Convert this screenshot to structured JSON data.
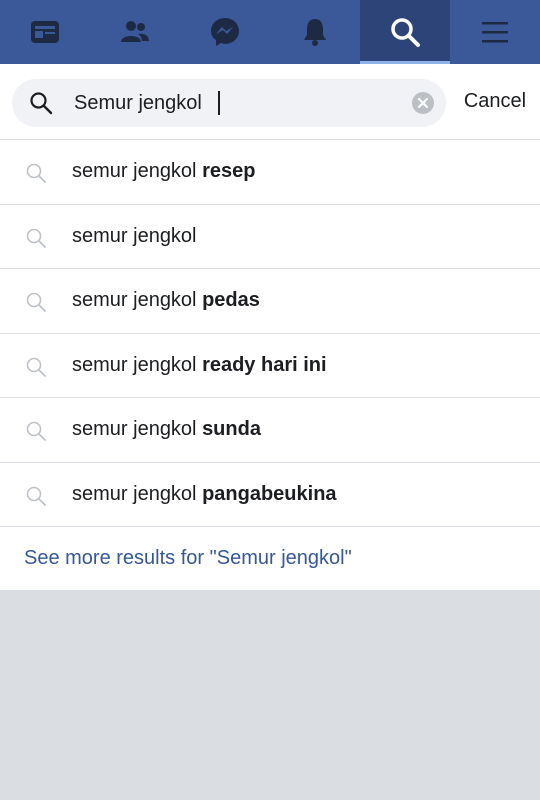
{
  "nav": {
    "items": [
      {
        "icon": "news-feed-icon"
      },
      {
        "icon": "friends-icon"
      },
      {
        "icon": "messenger-icon"
      },
      {
        "icon": "notifications-bell-icon"
      },
      {
        "icon": "search-icon",
        "active": true
      },
      {
        "icon": "menu-icon"
      }
    ],
    "colors": {
      "bar": "#3b5998",
      "active": "#2d4479",
      "indicator": "#8eb3e8"
    }
  },
  "search": {
    "value": "Semur jengkol",
    "cancel_label": "Cancel"
  },
  "suggestions": [
    {
      "prefix": "semur jengkol ",
      "bold": "resep"
    },
    {
      "prefix": "semur jengkol",
      "bold": ""
    },
    {
      "prefix": "semur jengkol ",
      "bold": "pedas"
    },
    {
      "prefix": "semur jengkol ",
      "bold": "ready hari ini"
    },
    {
      "prefix": "semur jengkol ",
      "bold": "sunda"
    },
    {
      "prefix": "semur jengkol ",
      "bold": "pangabeukina"
    }
  ],
  "see_more_label": "See more results for \"Semur jengkol\""
}
